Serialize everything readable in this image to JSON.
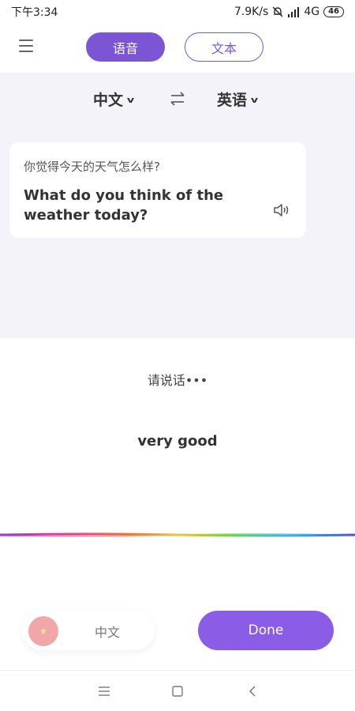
{
  "status": {
    "time": "下午3:34",
    "speed": "7.9K/s",
    "network": "4G",
    "battery": "46"
  },
  "header": {
    "tab_voice": "语音",
    "tab_text": "文本"
  },
  "languages": {
    "source": "中文",
    "target": "英语"
  },
  "translation": {
    "source_text": "你觉得今天的天气怎么样?",
    "translated_text": "What do you think of the weather today?"
  },
  "listening": {
    "prompt": "请说话•••",
    "recognized_text": "very good"
  },
  "bottom": {
    "language_chip": "中文",
    "done_label": "Done"
  },
  "colors": {
    "accent": "#7b55d4",
    "done_button": "#8b5ce6",
    "panel_bg": "#f4f3f9"
  }
}
